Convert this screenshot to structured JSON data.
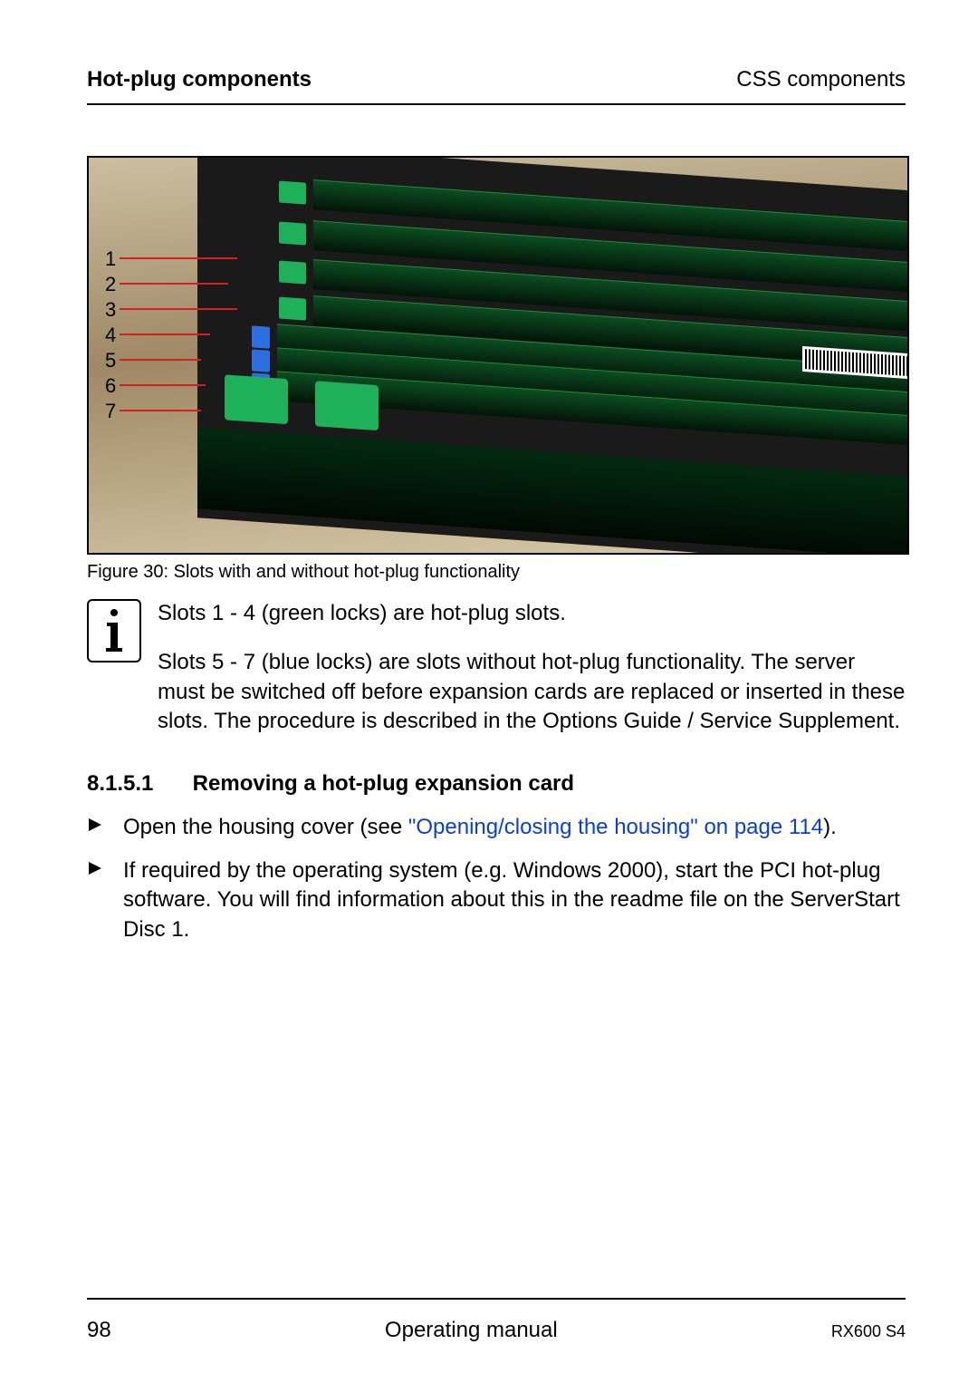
{
  "header": {
    "left": "Hot-plug components",
    "right": "CSS components"
  },
  "figure": {
    "labels": [
      "1",
      "2",
      "3",
      "4",
      "5",
      "6",
      "7"
    ],
    "caption": "Figure 30: Slots with and without hot-plug functionality"
  },
  "info": {
    "para1": "Slots 1 - 4 (green locks) are hot-plug slots.",
    "para2": "Slots 5 - 7 (blue locks) are slots without hot-plug functionality. The server must be switched off before expansion cards are replaced or inserted in these slots. The procedure is described in the Options Guide / Service Supplement."
  },
  "subheading": {
    "number": "8.1.5.1",
    "title": "Removing a hot-plug expansion card"
  },
  "bullets": {
    "b1_pre": "Open the housing cover (see ",
    "b1_link": "\"Opening/closing the housing\" on page 114",
    "b1_post": ").",
    "b2": "If required by the operating system (e.g. Windows 2000), start the PCI hot-plug software. You will find information about this in the readme file on the ServerStart Disc 1."
  },
  "footer": {
    "page": "98",
    "center": "Operating manual",
    "model": "RX600 S4"
  }
}
